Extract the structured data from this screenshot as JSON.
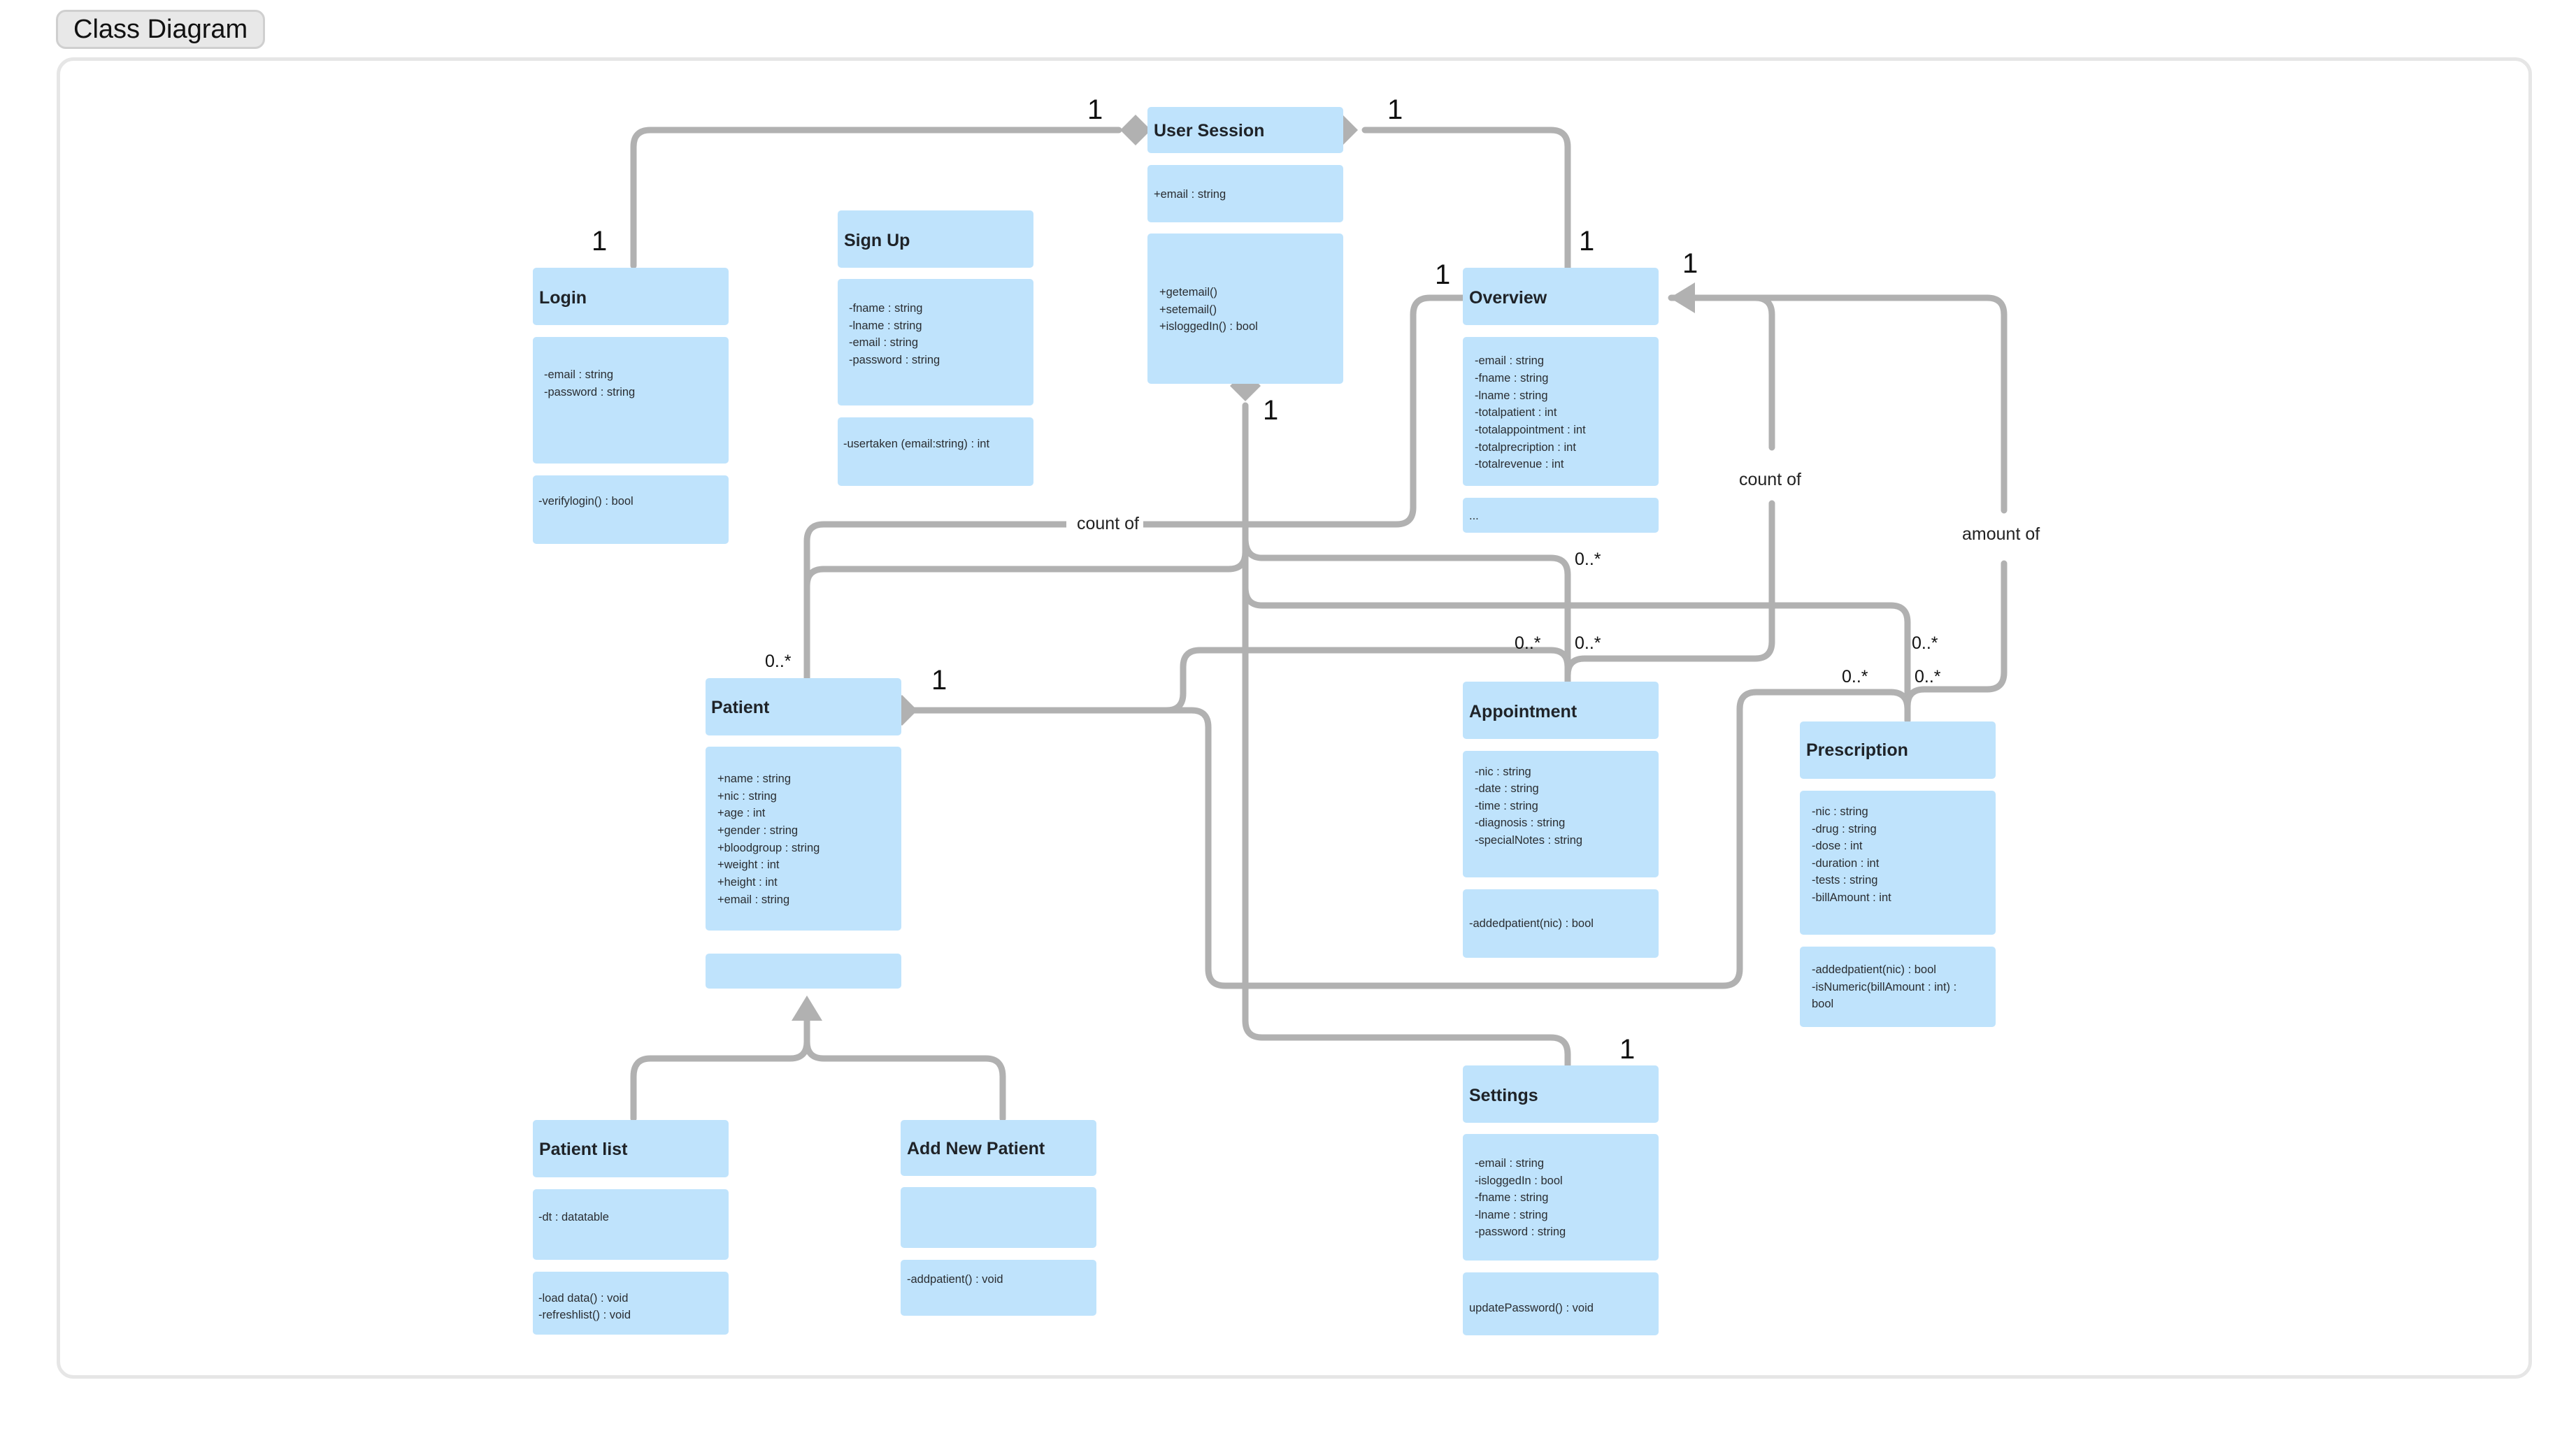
{
  "header": {
    "title": "Class Diagram"
  },
  "theme": {
    "class_fill": "#bfe3fc",
    "connector": "#b1b1b1",
    "frame_border": "#e6e6e6"
  },
  "classes": {
    "user_session": {
      "name": "User Session",
      "attributes": [
        "+email : string"
      ],
      "methods": [
        "+getemail()",
        "+setemail()",
        "+isloggedIn() : bool"
      ]
    },
    "login": {
      "name": "Login",
      "attributes": [
        "-email : string",
        "-password : string"
      ],
      "methods": [
        "-verifylogin() : bool"
      ]
    },
    "sign_up": {
      "name": "Sign Up",
      "attributes": [
        "-fname : string",
        "-lname : string",
        "-email : string",
        "-password : string"
      ],
      "methods": [
        "-usertaken (email:string) : int"
      ]
    },
    "overview": {
      "name": "Overview",
      "attributes": [
        "-email : string",
        "-fname : string",
        "-lname : string",
        "-totalpatient : int",
        "-totalappointment : int",
        "-totalprecription : int",
        "-totalrevenue : int"
      ],
      "methods": [
        "..."
      ]
    },
    "patient": {
      "name": "Patient",
      "attributes": [
        "+name : string",
        "+nic : string",
        "+age : int",
        "+gender : string",
        "+bloodgroup : string",
        "+weight : int",
        "+height : int",
        "+email : string"
      ],
      "methods": []
    },
    "appointment": {
      "name": "Appointment",
      "attributes": [
        "-nic : string",
        "-date : string",
        "-time : string",
        "-diagnosis : string",
        "-specialNotes : string"
      ],
      "methods": [
        "-addedpatient(nic) : bool"
      ]
    },
    "prescription": {
      "name": "Prescription",
      "attributes": [
        "-nic : string",
        "-drug : string",
        "-dose : int",
        "-duration : int",
        "-tests : string",
        "-billAmount : int"
      ],
      "methods": [
        "-addedpatient(nic) : bool",
        "-isNumeric(billAmount : int) :",
        "bool"
      ]
    },
    "patient_list": {
      "name": "Patient list",
      "attributes": [
        "-dt : datatable"
      ],
      "methods": [
        "-load data() : void",
        "-refreshlist() : void"
      ]
    },
    "add_new_patient": {
      "name": "Add New Patient",
      "attributes": [],
      "methods": [
        "-addpatient() : void"
      ]
    },
    "settings": {
      "name": "Settings",
      "attributes": [
        "-email : string",
        "-isloggedIn : bool",
        "-fname : string",
        "-lname : string",
        "-password : string"
      ],
      "methods": [
        "updatePassword() : void"
      ]
    }
  },
  "relations": {
    "labels": {
      "count_of_patient": "count of",
      "count_of_appointment": "count of",
      "amount_of": "amount of"
    },
    "multiplicities": {
      "session_left": "1",
      "session_right": "1",
      "login_top": "1",
      "overview_top": "1",
      "overview_left": "1",
      "overview_right": "1",
      "session_bottom": "1",
      "patient_top": "0..*",
      "patient_right": "1",
      "appointment_a": "0..*",
      "appointment_b": "0..*",
      "appointment_c": "0..*",
      "prescription_a": "0..*",
      "prescription_b": "0..*",
      "prescription_c": "0..*",
      "settings_top": "1"
    }
  }
}
